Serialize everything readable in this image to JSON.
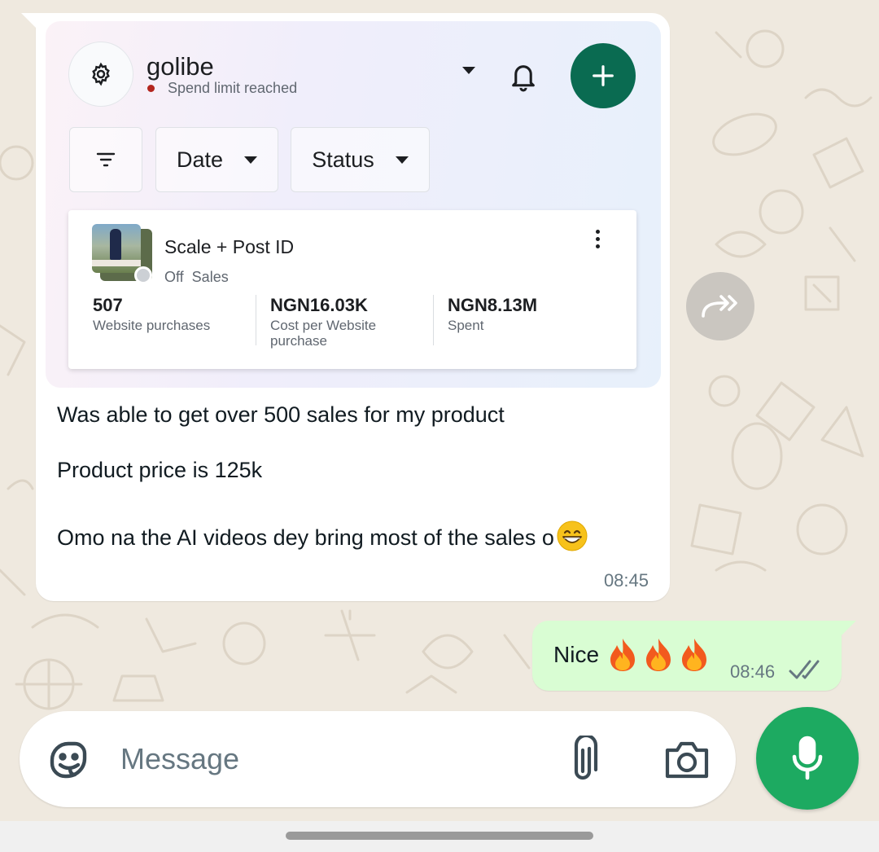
{
  "chat": {
    "incoming": {
      "ad_card": {
        "account_name": "golibe",
        "account_status": "Spend limit reached",
        "filters": {
          "date_label": "Date",
          "status_label": "Status"
        },
        "campaign": {
          "title": "Scale + Post ID",
          "subtitle": "Off  Sales",
          "metrics": [
            {
              "value": "507",
              "label": "Website purchases"
            },
            {
              "value": "NGN16.03K",
              "label": "Cost per Website purchase"
            },
            {
              "value": "NGN8.13M",
              "label": "Spent"
            }
          ]
        }
      },
      "lines": [
        "Was able to get over 500 sales for my product",
        "Product price is 125k",
        "Omo na the AI videos dey bring most of the sales o"
      ],
      "time": "08:45"
    },
    "outgoing": {
      "text": "Nice",
      "emoji_count": 3,
      "time": "08:46",
      "status": "read"
    }
  },
  "composer": {
    "placeholder": "Message"
  },
  "icons": {
    "settings": "gear-icon",
    "bell": "bell-icon",
    "add": "plus-icon",
    "filter": "filter-icon",
    "forward": "forward-icon",
    "sticker": "sticker-icon",
    "attach": "paperclip-icon",
    "camera": "camera-icon",
    "mic": "microphone-icon"
  },
  "colors": {
    "chat_bg": "#efe9df",
    "outgoing_bubble": "#d9fdd3",
    "mic_button": "#1daa61",
    "ad_primary": "#0a6b51",
    "status_dot": "#b3261e"
  }
}
